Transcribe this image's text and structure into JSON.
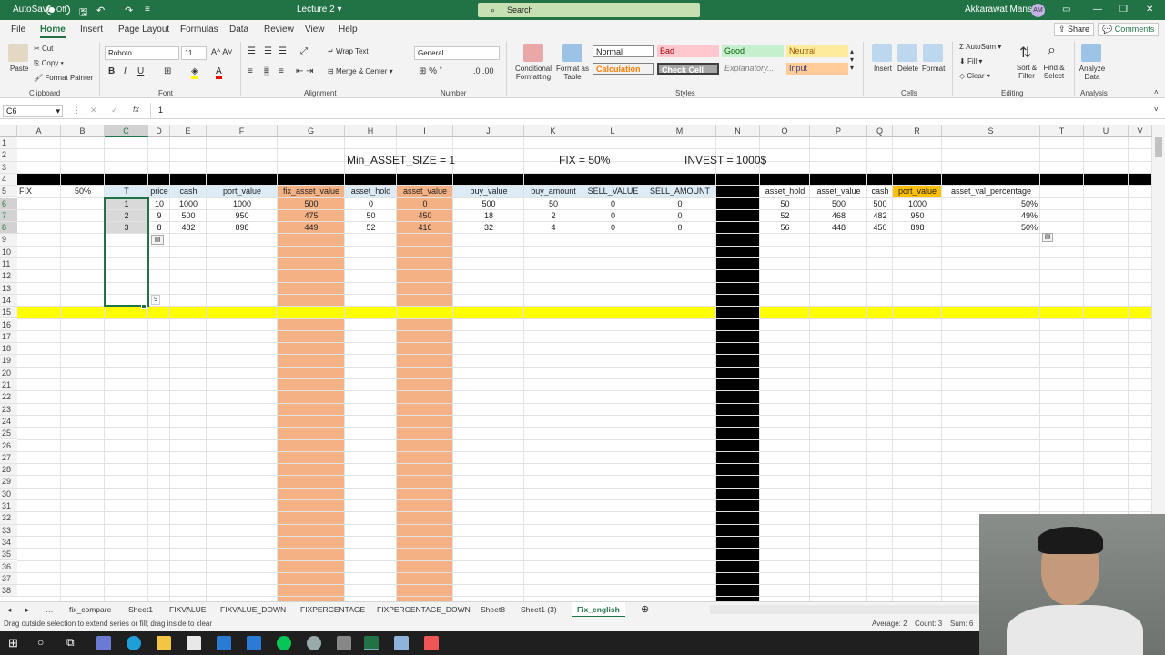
{
  "titlebar": {
    "autosave": "AutoSave",
    "autosave_state": "Off",
    "doc": "Lecture 2",
    "search": "Search",
    "user": "Akkarawat Mansap",
    "initials": "AM"
  },
  "menu": {
    "tabs": [
      "File",
      "Home",
      "Insert",
      "Page Layout",
      "Formulas",
      "Data",
      "Review",
      "View",
      "Help"
    ],
    "share": "Share",
    "comments": "Comments"
  },
  "ribbon": {
    "paste": "Paste",
    "cut": "Cut",
    "copy": "Copy",
    "format_painter": "Format Painter",
    "clipboard": "Clipboard",
    "font_name": "Roboto",
    "font_size": "11",
    "font": "Font",
    "wrap": "Wrap Text",
    "merge": "Merge & Center",
    "alignment": "Alignment",
    "number_format": "General",
    "number": "Number",
    "cond": "Conditional Formatting",
    "format_table": "Format as Table",
    "styles": [
      "Normal",
      "Bad",
      "Good",
      "Neutral",
      "Calculation",
      "Check Cell",
      "Explanatory...",
      "Input"
    ],
    "styles_label": "Styles",
    "insert": "Insert",
    "delete": "Delete",
    "format": "Format",
    "cells": "Cells",
    "autosum": "AutoSum",
    "fill": "Fill",
    "clear": "Clear",
    "sort": "Sort & Filter",
    "find": "Find & Select",
    "editing": "Editing",
    "analyze": "Analyze Data",
    "analysis": "Analysis"
  },
  "formula": {
    "namebox": "C6",
    "content": "1"
  },
  "columns": [
    "A",
    "B",
    "C",
    "D",
    "E",
    "F",
    "G",
    "H",
    "I",
    "J",
    "K",
    "L",
    "M",
    "N",
    "O",
    "P",
    "Q",
    "R",
    "S",
    "T",
    "U",
    "V"
  ],
  "rows": [
    "1",
    "2",
    "3",
    "4",
    "5",
    "6",
    "7",
    "8",
    "9",
    "10",
    "11",
    "12",
    "13",
    "14",
    "15",
    "16",
    "17",
    "18",
    "19",
    "20",
    "21",
    "22",
    "23",
    "24",
    "25",
    "26",
    "27",
    "28",
    "29",
    "30",
    "31",
    "32",
    "33",
    "34",
    "35",
    "36",
    "37",
    "38"
  ],
  "top": {
    "min_asset": "Min_ASSET_SIZE = 1",
    "fix": "FIX = 50%",
    "invest": "INVEST = 1000$"
  },
  "row5": {
    "a": "FIX",
    "b": "50%"
  },
  "headers_left": [
    "T",
    "price",
    "cash",
    "port_value",
    "fix_asset_value",
    "asset_hold",
    "asset_value",
    "buy_value",
    "buy_amount",
    "SELL_VALUE",
    "SELL_AMOUNT"
  ],
  "rows_left": [
    [
      "1",
      "10",
      "1000",
      "1000",
      "500",
      "0",
      "0",
      "500",
      "50",
      "0",
      "0"
    ],
    [
      "2",
      "9",
      "500",
      "950",
      "475",
      "50",
      "450",
      "18",
      "2",
      "0",
      "0"
    ],
    [
      "3",
      "8",
      "482",
      "898",
      "449",
      "52",
      "416",
      "32",
      "4",
      "0",
      "0"
    ]
  ],
  "headers_right": [
    "asset_hold",
    "asset_value",
    "cash",
    "port_value",
    "asset_val_percentage"
  ],
  "rows_right": [
    [
      "50",
      "500",
      "500",
      "1000",
      "50%"
    ],
    [
      "52",
      "468",
      "482",
      "950",
      "49%"
    ],
    [
      "56",
      "448",
      "450",
      "898",
      "50%"
    ]
  ],
  "fill_hint": "9",
  "sheets": [
    "fix_compare",
    "Sheet1",
    "FIXVALUE",
    "FIXVALUE_DOWN",
    "FIXPERCENTAGE",
    "FIXPERCENTAGE_DOWN",
    "Sheet8",
    "Sheet1 (3)",
    "Fix_english"
  ],
  "status": {
    "msg": "Drag outside selection to extend series or fill; drag inside to clear",
    "average": "Average: 2",
    "count": "Count: 3",
    "sum": "Sum: 6"
  },
  "colors": {
    "excel_green": "#217346",
    "orange_col": "#f4b183",
    "header_blue": "#ddebf7",
    "yellow_row": "#ffff00",
    "black_band": "#000000",
    "port_value_hdr": "#ffc000"
  }
}
